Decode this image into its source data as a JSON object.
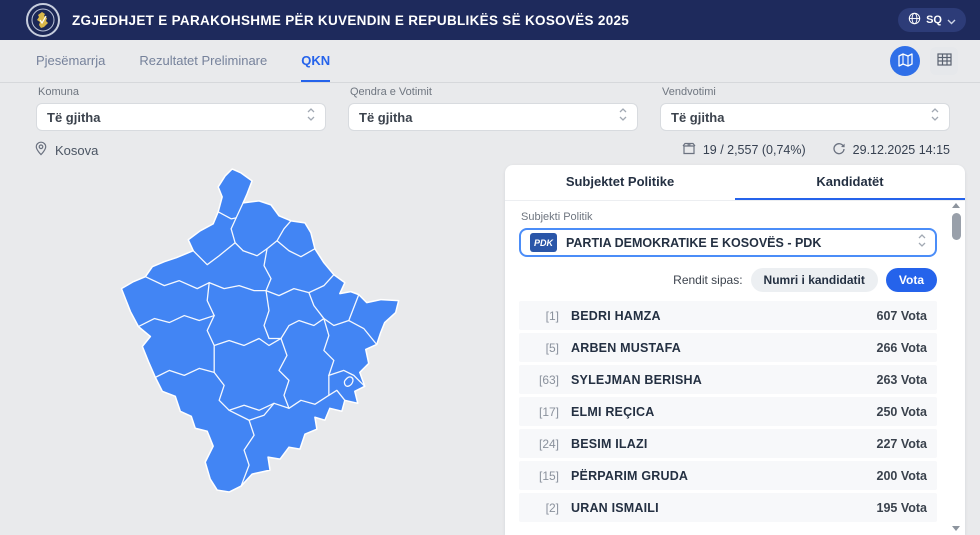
{
  "header": {
    "title": "ZGJEDHJET E PARAKOHSHME PËR KUVENDIN E REPUBLIKËS SË KOSOVËS 2025",
    "language": "SQ"
  },
  "tabs": [
    {
      "label": "Pjesëmarrja",
      "active": false
    },
    {
      "label": "Rezultatet Preliminare",
      "active": false
    },
    {
      "label": "QKN",
      "active": true
    }
  ],
  "filters": [
    {
      "label": "Komuna",
      "value": "Të gjitha"
    },
    {
      "label": "Qendra e Votimit",
      "value": "Të gjitha"
    },
    {
      "label": "Vendvotimi",
      "value": "Të gjitha"
    }
  ],
  "status": {
    "location": "Kosova",
    "counted": "19 / 2,557 (0,74%)",
    "updated": "29.12.2025 14:15"
  },
  "panel": {
    "tabs": [
      {
        "label": "Subjektet Politike",
        "active": false
      },
      {
        "label": "Kandidatët",
        "active": true
      }
    ],
    "subject_label": "Subjekti Politik",
    "subject_logo": "PDK",
    "subject_value": "PARTIA DEMOKRATIKE E KOSOVËS - PDK",
    "sort_label": "Rendit sipas:",
    "sort_options": [
      {
        "label": "Numri i kandidatit",
        "active": false
      },
      {
        "label": "Vota",
        "active": true
      }
    ],
    "candidates": [
      {
        "number": "[1]",
        "name": "BEDRI HAMZA",
        "votes": "607 Vota"
      },
      {
        "number": "[5]",
        "name": "ARBEN MUSTAFA",
        "votes": "266 Vota"
      },
      {
        "number": "[63]",
        "name": "SYLEJMAN BERISHA",
        "votes": "263 Vota"
      },
      {
        "number": "[17]",
        "name": "ELMI REÇICA",
        "votes": "250 Vota"
      },
      {
        "number": "[24]",
        "name": "BESIM ILAZI",
        "votes": "227 Vota"
      },
      {
        "number": "[15]",
        "name": "PËRPARIM GRUDA",
        "votes": "200 Vota"
      },
      {
        "number": "[2]",
        "name": "URAN ISMAILI",
        "votes": "195 Vota"
      }
    ]
  },
  "icons": {
    "logo": "kosovo-emblem",
    "language": "translate-globe",
    "lang_chevron": "chevron-down",
    "view_map": "map",
    "view_table": "table",
    "select_spinner": "up-down-chevrons",
    "location": "map-pin",
    "counted": "ballot-box",
    "updated": "refresh"
  },
  "colors": {
    "header_bg": "#1e2a5c",
    "page_bg": "#e9eaec",
    "accent_blue": "#2563eb",
    "map_fill": "#4285f4",
    "pdk_badge": "#2a56a8",
    "row_bg": "#f7f8fa"
  }
}
